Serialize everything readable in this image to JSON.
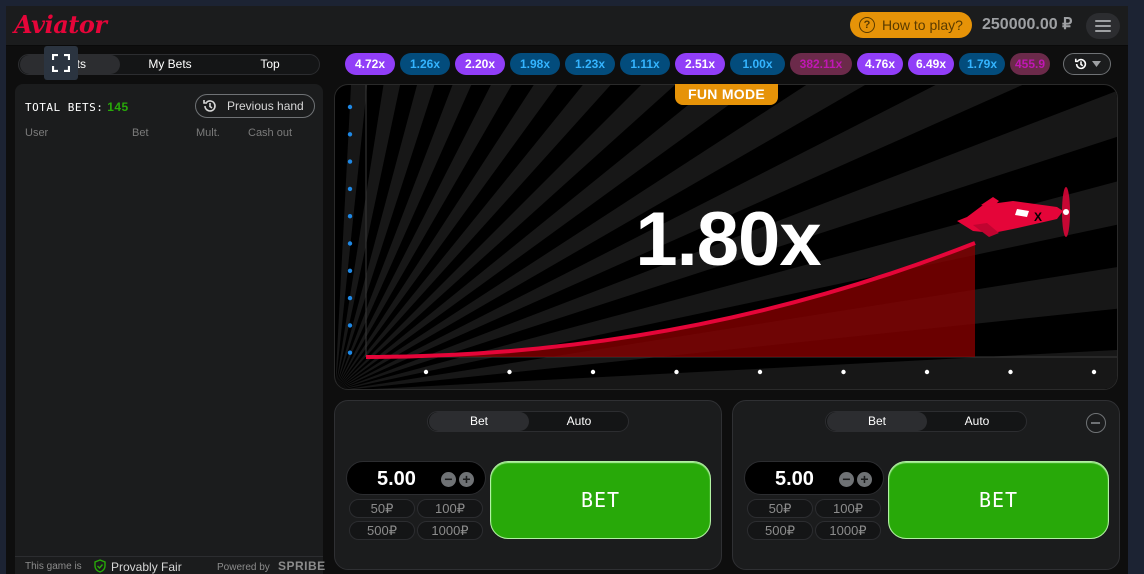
{
  "header": {
    "logo": "Aviator",
    "how_to_play": "How to play?",
    "balance": "250000.00 ₽"
  },
  "left_panel": {
    "tabs": [
      "All Bets",
      "My Bets",
      "Top"
    ],
    "tab_all_visible": "ets",
    "total_bets_label": "TOTAL BETS:",
    "total_bets_count": "145",
    "previous_hand": "Previous hand",
    "columns": [
      "User",
      "Bet",
      "Mult.",
      "Cash out"
    ],
    "footer": {
      "game_is": "This game is",
      "provably_fair": "Provably Fair",
      "powered_by": "Powered by",
      "brand": "SPRIBE"
    }
  },
  "history": [
    {
      "value": "4.72x",
      "color": "purple"
    },
    {
      "value": "1.26x",
      "color": "blue"
    },
    {
      "value": "2.20x",
      "color": "purple"
    },
    {
      "value": "1.98x",
      "color": "blue"
    },
    {
      "value": "1.23x",
      "color": "blue"
    },
    {
      "value": "1.11x",
      "color": "blue"
    },
    {
      "value": "2.51x",
      "color": "purple"
    },
    {
      "value": "1.00x",
      "color": "blue"
    },
    {
      "value": "382.11x",
      "color": "pink"
    },
    {
      "value": "4.76x",
      "color": "purple"
    },
    {
      "value": "6.49x",
      "color": "purple"
    },
    {
      "value": "1.79x",
      "color": "blue"
    },
    {
      "value": "455.9",
      "color": "pink"
    }
  ],
  "stage": {
    "fun_mode": "FUN MODE",
    "multiplier": "1.80x"
  },
  "bet_panels": [
    {
      "tabs": [
        "Bet",
        "Auto"
      ],
      "amount": "5.00",
      "chips": [
        "50₽",
        "100₽",
        "500₽",
        "1000₽"
      ],
      "bet_label": "BET"
    },
    {
      "tabs": [
        "Bet",
        "Auto"
      ],
      "amount": "5.00",
      "chips": [
        "50₽",
        "100₽",
        "500₽",
        "1000₽"
      ],
      "bet_label": "BET"
    }
  ],
  "colors": {
    "accent_red": "#e50539",
    "bet_green": "#28a909",
    "fun_mode_orange": "#e69308",
    "mult_purple": "#913ef8",
    "mult_blue": "#34b4ff",
    "mult_pink": "#c017b4"
  }
}
